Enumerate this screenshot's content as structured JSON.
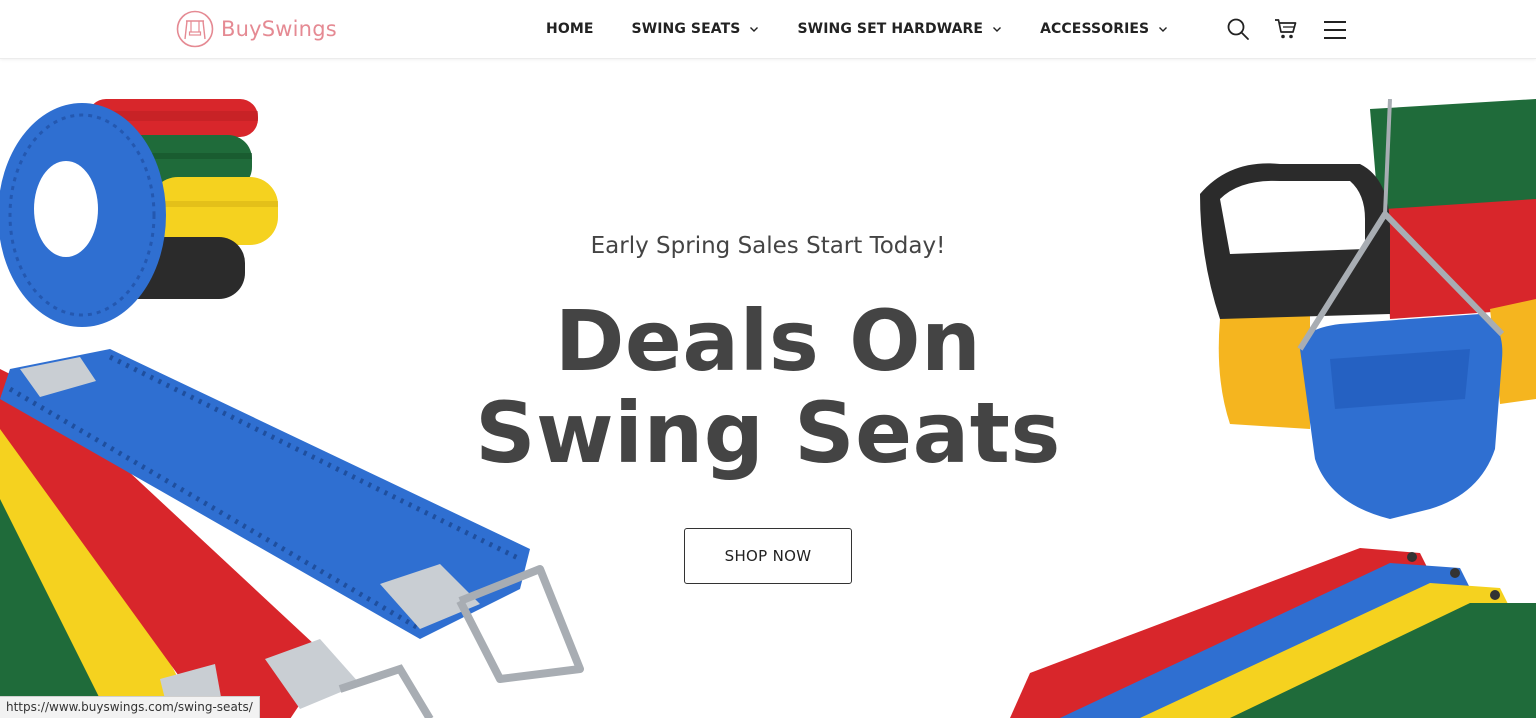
{
  "brand": {
    "name": "BuySwings",
    "logo_color": "#e58a93"
  },
  "nav": {
    "items": [
      {
        "label": "HOME",
        "has_dropdown": false
      },
      {
        "label": "SWING SEATS",
        "has_dropdown": true
      },
      {
        "label": "SWING SET HARDWARE",
        "has_dropdown": true
      },
      {
        "label": "ACCESSORIES",
        "has_dropdown": true
      }
    ]
  },
  "header_icons": [
    "search-icon",
    "cart-icon",
    "menu-icon"
  ],
  "hero": {
    "subtitle": "Early Spring Sales Start Today!",
    "title": "Deals On Swing Seats",
    "cta_label": "SHOP NOW"
  },
  "status_bar": {
    "url": "https://www.buyswings.com/swing-seats/"
  },
  "colors": {
    "text_dark": "#444444",
    "swing_blue": "#2f6fd1",
    "swing_red": "#d8262b",
    "swing_yellow": "#f5d21f",
    "swing_green": "#1f6b3a",
    "swing_black": "#2b2b2b"
  }
}
